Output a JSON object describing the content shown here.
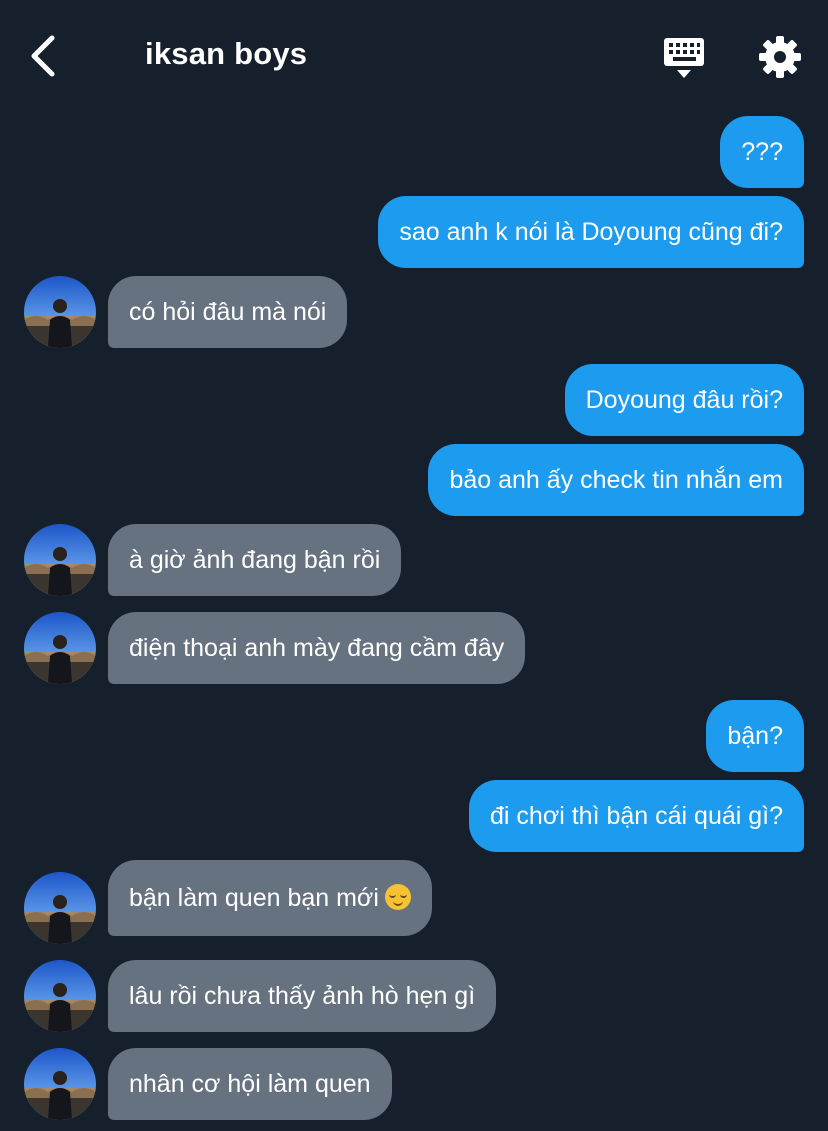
{
  "header": {
    "title": "iksan boys",
    "back_icon": "chevron-left-icon",
    "keyboard_icon": "keyboard-icon",
    "settings_icon": "gear-icon"
  },
  "colors": {
    "background": "#16202c",
    "sent_bubble": "#1c9bef",
    "received_bubble": "#66727f",
    "text": "#ffffff"
  },
  "messages": [
    {
      "from": "me",
      "text": "???"
    },
    {
      "from": "me",
      "text": "sao anh k nói là Doyoung cũng đi?"
    },
    {
      "from": "them",
      "text": "có hỏi đâu mà nói"
    },
    {
      "from": "me",
      "text": "Doyoung đâu rồi?"
    },
    {
      "from": "me",
      "text": "bảo anh ấy check tin nhắn em"
    },
    {
      "from": "them",
      "text": "à giờ ảnh đang bận rồi"
    },
    {
      "from": "them",
      "text": "điện thoại anh mày đang cầm đây"
    },
    {
      "from": "me",
      "text": "bận?"
    },
    {
      "from": "me",
      "text": "đi chơi thì bận cái quái gì?"
    },
    {
      "from": "them",
      "text": "bận làm quen bạn mới",
      "emoji": "relieved-face-emoji"
    },
    {
      "from": "them",
      "text": "lâu rồi chưa thấy ảnh hò hẹn gì"
    },
    {
      "from": "them",
      "text": "nhân cơ hội làm quen"
    }
  ]
}
